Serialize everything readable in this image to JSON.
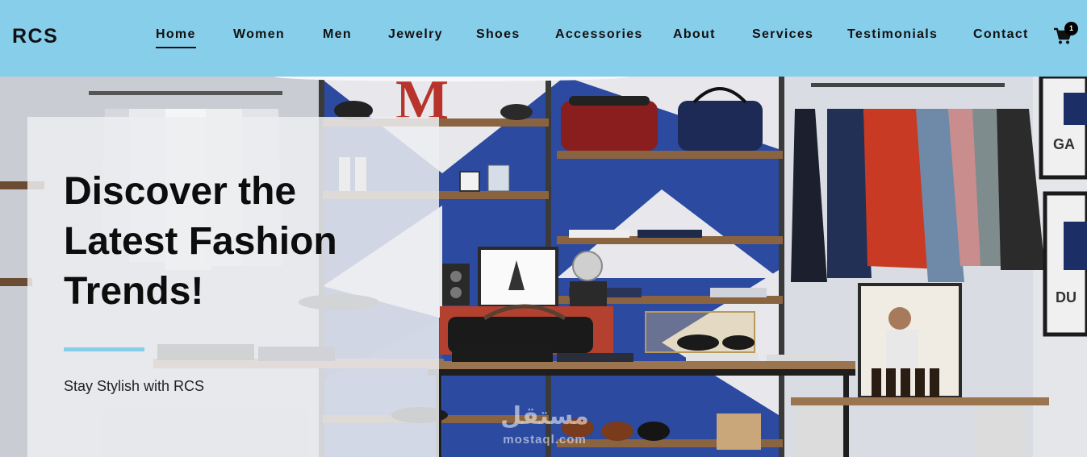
{
  "brand": "RCS",
  "nav": {
    "items": [
      {
        "label": "Home",
        "active": true
      },
      {
        "label": "Women"
      },
      {
        "label": "Men"
      },
      {
        "label": "Jewelry"
      },
      {
        "label": "Shoes"
      },
      {
        "label": "Accessories"
      },
      {
        "label": "About"
      },
      {
        "label": "Services"
      },
      {
        "label": "Testimonials"
      },
      {
        "label": "Contact"
      }
    ],
    "cart_count": "1",
    "cart_icon": "shopping-cart-icon"
  },
  "hero": {
    "title": "Discover the Latest Fashion Trends!",
    "subtitle": "Stay Stylish with RCS",
    "accent_color": "#87ceeb",
    "background_image": "clothing store interior with shelves, bags, shoes and hanging jackets"
  },
  "watermark": {
    "text": "mostaql.com"
  },
  "colors": {
    "navbar": "#87ceeb",
    "text": "#111111",
    "badge": "#000000"
  }
}
